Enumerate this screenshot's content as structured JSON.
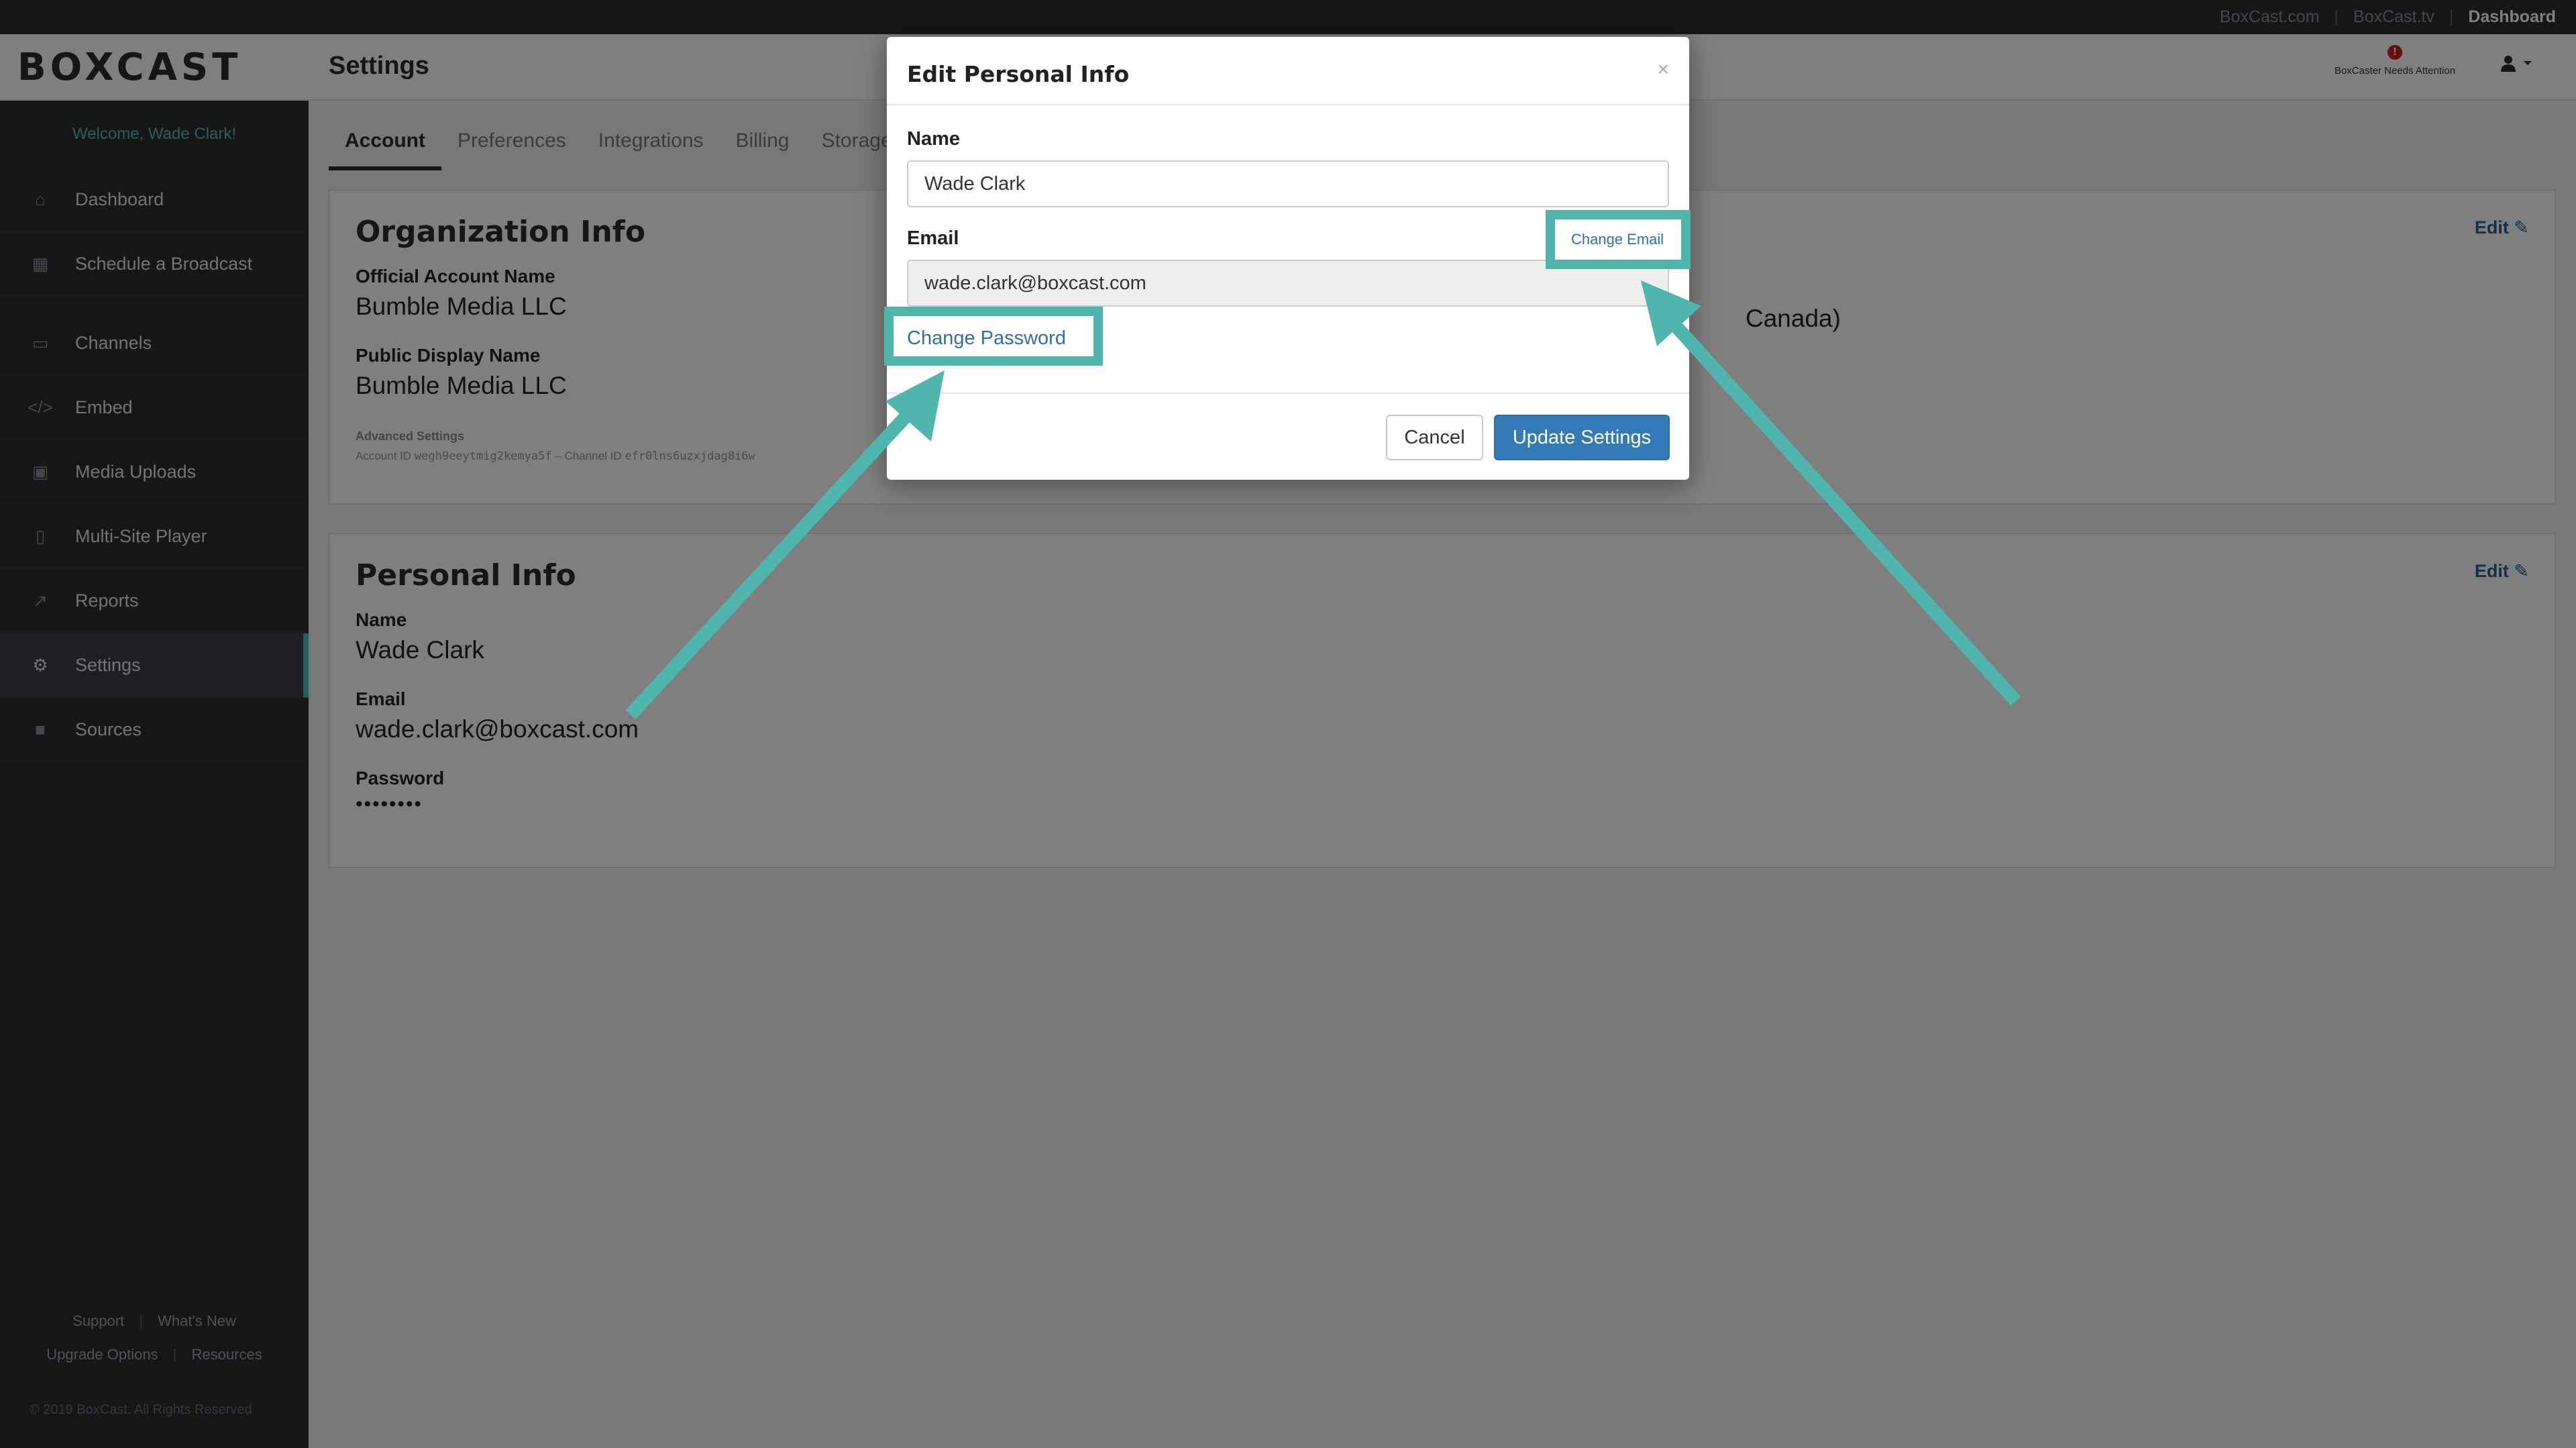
{
  "topbar": {
    "links": [
      "BoxCast.com",
      "BoxCast.tv",
      "Dashboard"
    ]
  },
  "header": {
    "logo": "BOXCAST",
    "page_title": "Settings",
    "alert_text": "BoxCaster Needs Attention",
    "alert_badge": "!"
  },
  "sidebar": {
    "welcome": "Welcome, Wade Clark!",
    "items": [
      {
        "label": "Dashboard",
        "icon": "home-icon"
      },
      {
        "label": "Schedule a Broadcast",
        "icon": "calendar-icon"
      },
      {
        "label": "Channels",
        "icon": "monitor-icon"
      },
      {
        "label": "Embed",
        "icon": "code-icon"
      },
      {
        "label": "Media Uploads",
        "icon": "image-icon"
      },
      {
        "label": "Multi-Site Player",
        "icon": "tablet-icon"
      },
      {
        "label": "Reports",
        "icon": "chart-icon"
      },
      {
        "label": "Settings",
        "icon": "gear-icon"
      },
      {
        "label": "Sources",
        "icon": "camera-icon"
      }
    ],
    "footer": {
      "support": "Support",
      "whats_new": "What's New",
      "upgrade": "Upgrade Options",
      "resources": "Resources",
      "copyright": "© 2019 BoxCast. All Rights Reserved"
    }
  },
  "tabs": [
    "Account",
    "Preferences",
    "Integrations",
    "Billing",
    "Storage"
  ],
  "org_card": {
    "title": "Organization Info",
    "edit": "Edit",
    "official_label": "Official Account Name",
    "official_value": "Bumble Media LLC",
    "public_label": "Public Display Name",
    "public_value": "Bumble Media LLC",
    "partial_value": "Canada)",
    "advanced_title": "Advanced Settings",
    "account_id_label": "Account ID",
    "account_id": "wegh9eeytmig2kemya5f",
    "channel_id_label": "Channel ID",
    "channel_id": "efr0lns6uzxjdag8i6w"
  },
  "personal_card": {
    "title": "Personal Info",
    "edit": "Edit",
    "name_label": "Name",
    "name_value": "Wade Clark",
    "email_label": "Email",
    "email_value": "wade.clark@boxcast.com",
    "password_label": "Password",
    "password_value": "••••••••"
  },
  "modal": {
    "title": "Edit Personal Info",
    "close": "×",
    "name_label": "Name",
    "name_value": "Wade Clark",
    "email_label": "Email",
    "email_value": "wade.clark@boxcast.com",
    "change_email": "Change Email",
    "change_password": "Change Password",
    "cancel": "Cancel",
    "update": "Update Settings"
  },
  "colors": {
    "highlight": "#4fb5ad",
    "primary": "#337ab7",
    "sidebar": "#2a2d31"
  }
}
